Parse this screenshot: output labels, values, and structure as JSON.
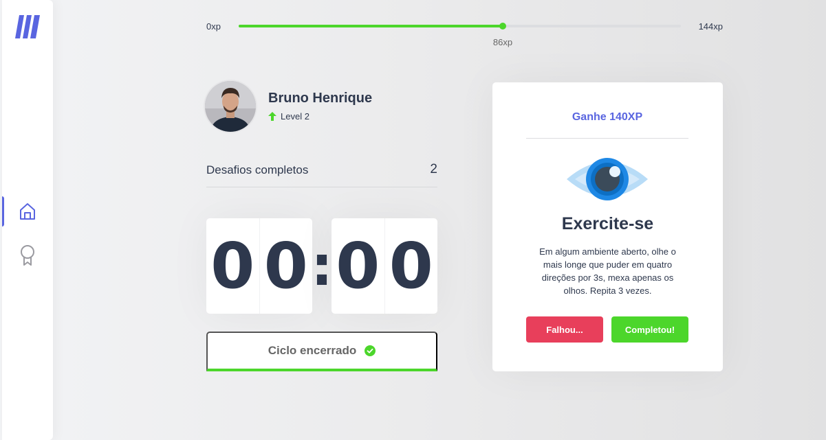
{
  "sidebar": {
    "logo_icon": "logo-icon",
    "items": [
      {
        "icon": "home-icon",
        "active": true
      },
      {
        "icon": "award-icon",
        "active": false
      }
    ]
  },
  "xp": {
    "min_label": "0xp",
    "max_label": "144xp",
    "current_label": "86xp",
    "current": 86,
    "max": 144
  },
  "profile": {
    "name": "Bruno Henrique",
    "level_label": "Level 2"
  },
  "challenges": {
    "label": "Desafios completos",
    "count": "2"
  },
  "countdown": {
    "minute_left": "0",
    "minute_right": "0",
    "separator": ":",
    "second_left": "0",
    "second_right": "0"
  },
  "cycle": {
    "label": "Ciclo encerrado",
    "icon": "check-circle-icon"
  },
  "card": {
    "header": "Ganhe 140XP",
    "icon": "eye-icon",
    "title": "Exercite-se",
    "description": "Em algum ambiente aberto, olhe o mais longe que puder em quatro direções por 3s, mexa apenas os olhos. Repita 3 vezes.",
    "fail_label": "Falhou...",
    "success_label": "Completou!"
  },
  "colors": {
    "accent": "#5965e0",
    "green": "#4cd62b",
    "red": "#e83f5b",
    "text": "#2e384d"
  }
}
